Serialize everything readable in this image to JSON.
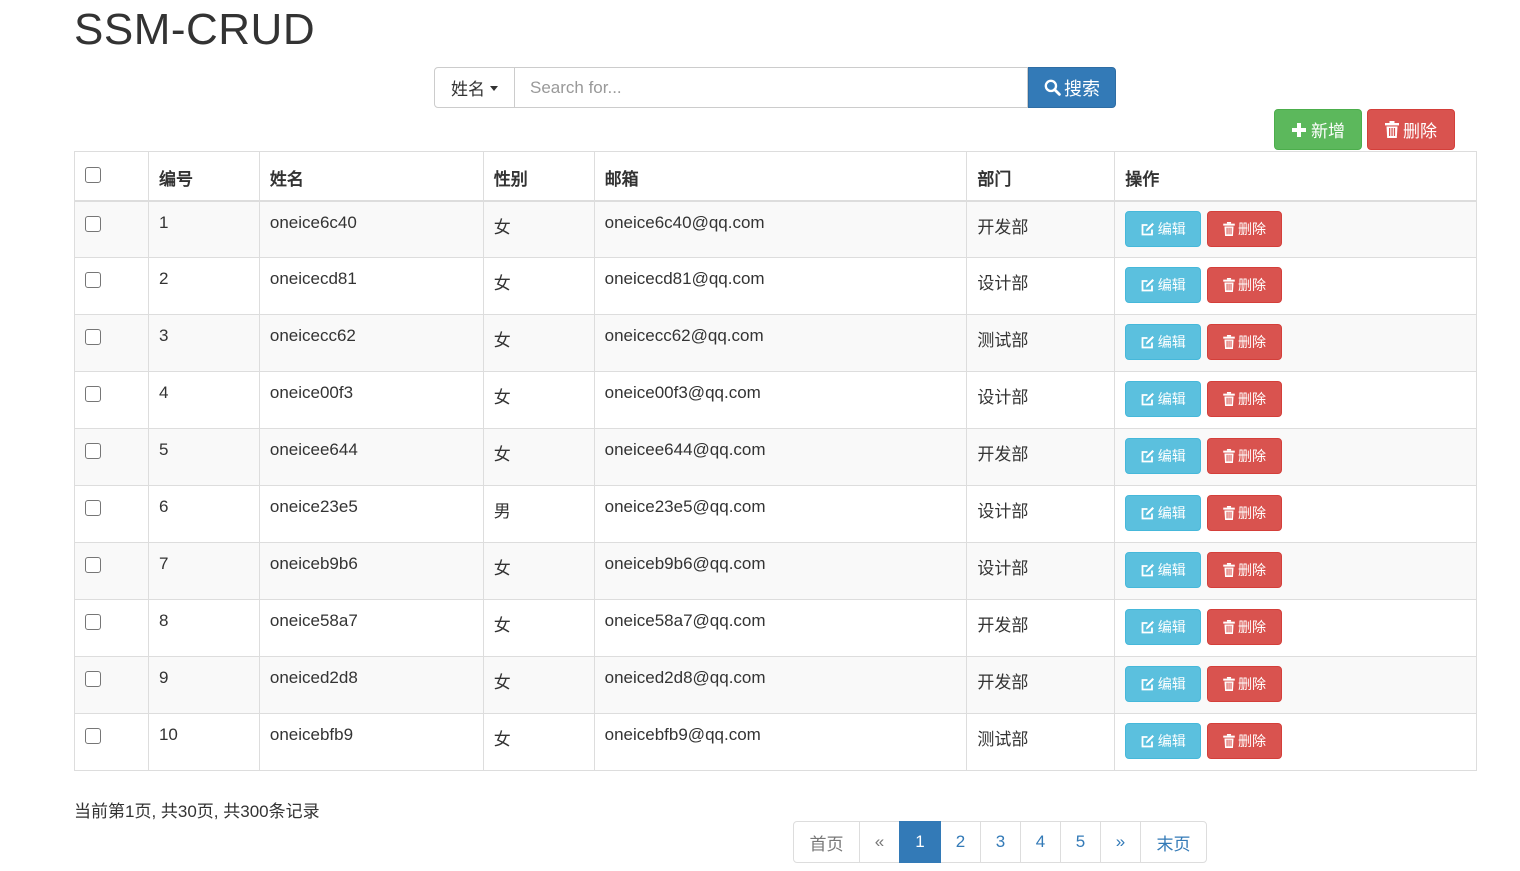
{
  "title": "SSM-CRUD",
  "search": {
    "field_label": "姓名",
    "placeholder": "Search for...",
    "button_label": "搜索"
  },
  "actions": {
    "add_label": "新增",
    "delete_label": "删除"
  },
  "table": {
    "headers": [
      "编号",
      "姓名",
      "性别",
      "邮箱",
      "部门",
      "操作"
    ],
    "edit_label": "编辑",
    "delete_label": "删除",
    "rows": [
      {
        "id": "1",
        "name": "oneice6c40",
        "gender": "女",
        "email": "oneice6c40@qq.com",
        "dept": "开发部"
      },
      {
        "id": "2",
        "name": "oneicecd81",
        "gender": "女",
        "email": "oneicecd81@qq.com",
        "dept": "设计部"
      },
      {
        "id": "3",
        "name": "oneicecc62",
        "gender": "女",
        "email": "oneicecc62@qq.com",
        "dept": "测试部"
      },
      {
        "id": "4",
        "name": "oneice00f3",
        "gender": "女",
        "email": "oneice00f3@qq.com",
        "dept": "设计部"
      },
      {
        "id": "5",
        "name": "oneicee644",
        "gender": "女",
        "email": "oneicee644@qq.com",
        "dept": "开发部"
      },
      {
        "id": "6",
        "name": "oneice23e5",
        "gender": "男",
        "email": "oneice23e5@qq.com",
        "dept": "设计部"
      },
      {
        "id": "7",
        "name": "oneiceb9b6",
        "gender": "女",
        "email": "oneiceb9b6@qq.com",
        "dept": "设计部"
      },
      {
        "id": "8",
        "name": "oneice58a7",
        "gender": "女",
        "email": "oneice58a7@qq.com",
        "dept": "开发部"
      },
      {
        "id": "9",
        "name": "oneiced2d8",
        "gender": "女",
        "email": "oneiced2d8@qq.com",
        "dept": "开发部"
      },
      {
        "id": "10",
        "name": "oneicebfb9",
        "gender": "女",
        "email": "oneicebfb9@qq.com",
        "dept": "测试部"
      }
    ]
  },
  "page_info": "当前第1页, 共30页, 共300条记录",
  "pagination": {
    "first": "首页",
    "prev": "«",
    "pages": [
      "1",
      "2",
      "3",
      "4",
      "5"
    ],
    "current": "1",
    "next": "»",
    "last": "末页"
  },
  "colors": {
    "primary": "#337ab7",
    "success": "#5cb85c",
    "danger": "#d9534f",
    "info": "#5bc0de"
  }
}
